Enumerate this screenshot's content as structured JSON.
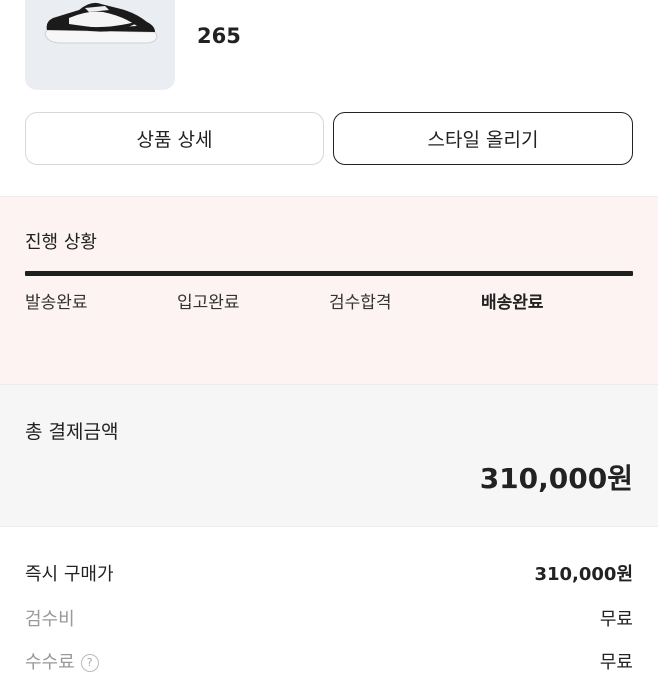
{
  "product": {
    "image_icon": "sneaker-icon",
    "size": "265"
  },
  "buttons": {
    "detail_label": "상품 상세",
    "style_label": "스타일 올리기"
  },
  "progress": {
    "title": "진행 상황",
    "steps": [
      "발송완료",
      "입고완료",
      "검수합격",
      "배송완료"
    ],
    "current_step_index": 3,
    "completion": 1.0
  },
  "total": {
    "label": "총 결제금액",
    "amount": "310,000원"
  },
  "details": [
    {
      "label": "즉시 구매가",
      "value": "310,000원"
    },
    {
      "label": "검수비",
      "value": "무료"
    },
    {
      "label": "수수료",
      "value": "무료"
    }
  ],
  "colors": {
    "progress_bg": "#fdf3f3",
    "progress_bar": "#1f1f1f",
    "total_bg": "#f6f6f6"
  }
}
